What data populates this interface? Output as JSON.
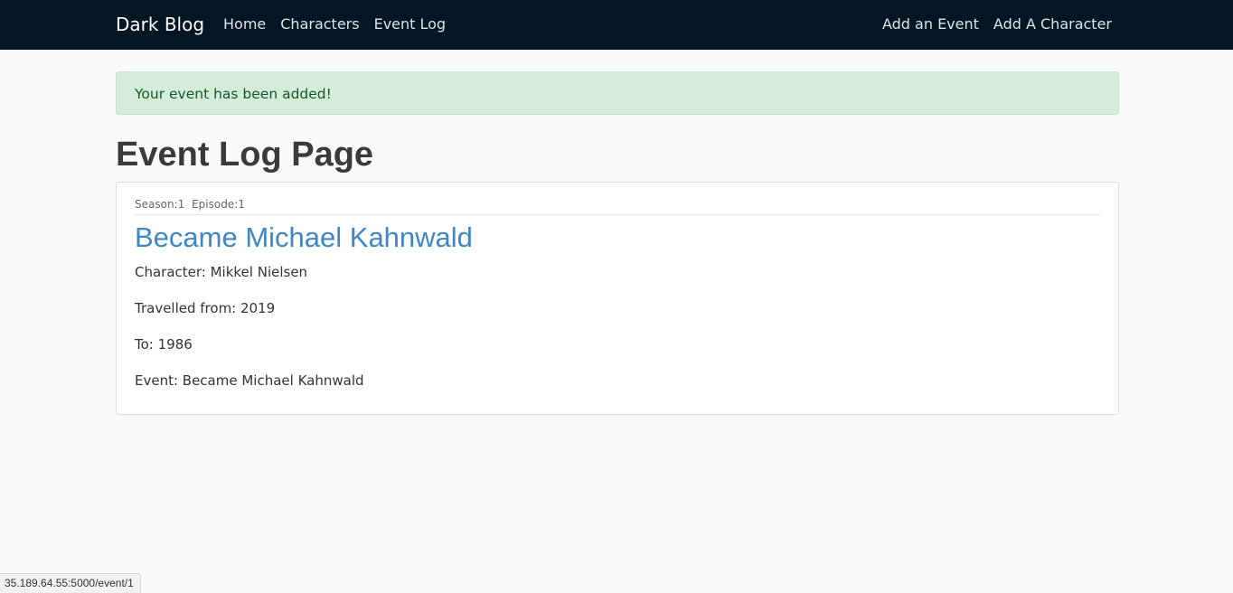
{
  "navbar": {
    "brand": "Dark Blog",
    "left_links": [
      {
        "label": "Home"
      },
      {
        "label": "Characters"
      },
      {
        "label": "Event Log"
      }
    ],
    "right_links": [
      {
        "label": "Add an Event"
      },
      {
        "label": "Add A Character"
      }
    ],
    "background_color": "#021624"
  },
  "alert": {
    "message": "Your event has been added!",
    "type": "success"
  },
  "page": {
    "title": "Event Log Page"
  },
  "events": [
    {
      "season_label": "Season:1",
      "episode_label": "Episode:1",
      "title": "Became Michael Kahnwald",
      "character_line": "Character: Mikkel Nielsen",
      "travelled_from_line": "Travelled from: 2019",
      "to_line": "To: 1986",
      "event_line": "Event: Became Michael Kahnwald"
    }
  ],
  "status_bar": {
    "url": "35.189.64.55:5000/event/1"
  },
  "colors": {
    "link": "#3e86c4",
    "alert_bg": "#d4edda",
    "alert_text": "#155724"
  }
}
